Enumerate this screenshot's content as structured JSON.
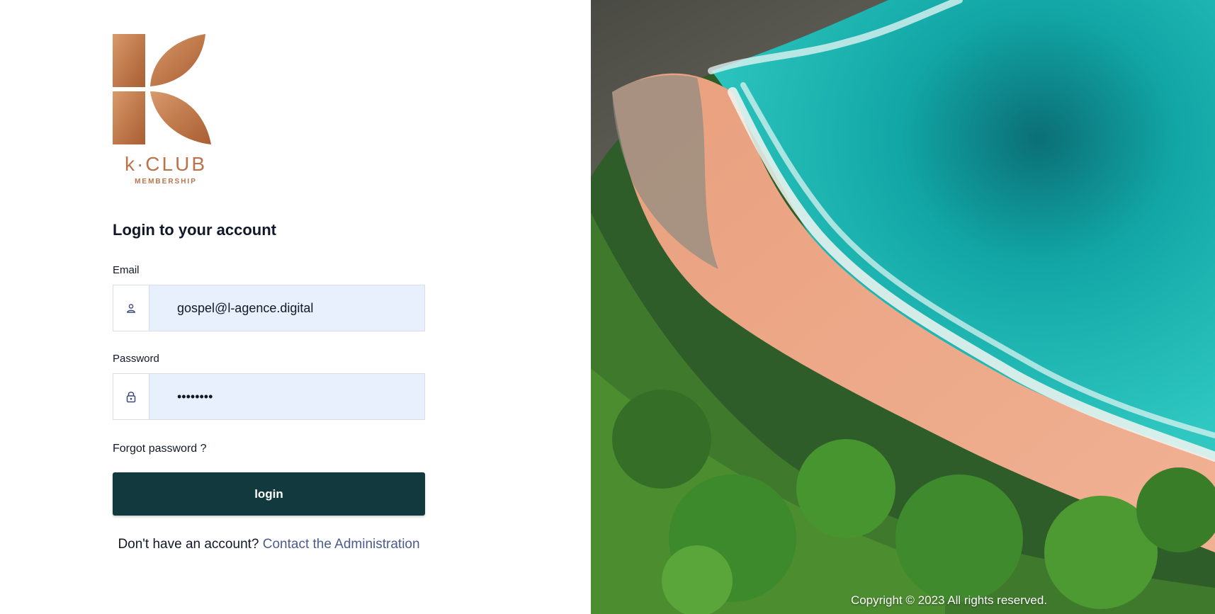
{
  "brand": {
    "name": "k·CLUB",
    "tagline": "MEMBERSHIP",
    "color": "#b8744a"
  },
  "form": {
    "title": "Login to your account",
    "email_label": "Email",
    "email_value": "gospel@l-agence.digital",
    "password_label": "Password",
    "password_value": "••••••••",
    "forgot_label": "Forgot password ?",
    "login_label": "login",
    "signup_prompt": "Don't have an account?",
    "signup_link": "Contact the Administration"
  },
  "icons": {
    "email": "user-icon",
    "password": "lock-icon"
  },
  "colors": {
    "button": "#123a3e",
    "input_bg": "#e8f0fe",
    "link": "#4b5b8c"
  },
  "footer": {
    "copyright": "Copyright © 2023 All rights reserved."
  }
}
